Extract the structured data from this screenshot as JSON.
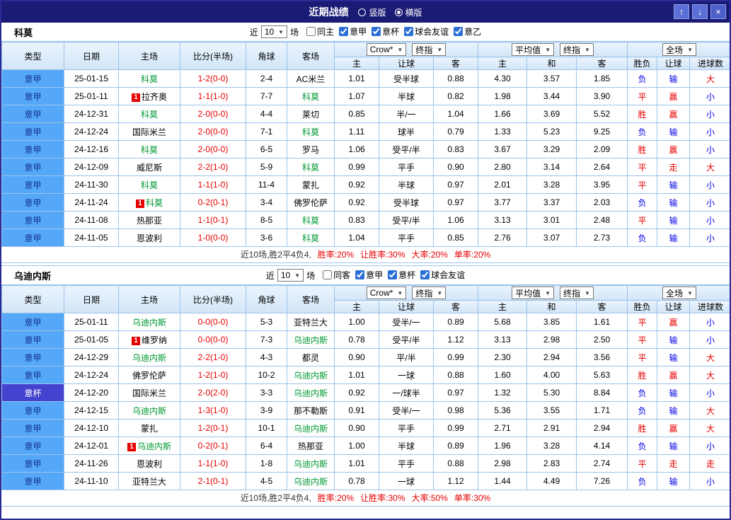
{
  "titlebar": {
    "title": "近期战绩",
    "radios": [
      {
        "label": "竖版",
        "checked": false
      },
      {
        "label": "横版",
        "checked": true
      }
    ],
    "up_icon": "↑",
    "down_icon": "↓",
    "close_icon": "×"
  },
  "columns": {
    "type": "类型",
    "date": "日期",
    "home": "主场",
    "score": "比分(半场)",
    "corner": "角球",
    "away": "客场",
    "odds_home": "主",
    "odds_handicap": "让球",
    "odds_away": "客",
    "avg_home": "主",
    "avg_draw": "和",
    "avg_away": "客",
    "result": "胜负",
    "handicap_result": "让球",
    "goals": "进球数"
  },
  "colors": {
    "accent_blue": "#55a8f8",
    "cup_blue": "#4343cf",
    "green_team": "#009933",
    "red": "#e60000",
    "blue": "#0000e6",
    "titlebar": "#1b1b75"
  },
  "sections": [
    {
      "team": "科莫",
      "filter": {
        "near": "近",
        "count": "10",
        "games": "场",
        "checkboxes": [
          {
            "label": "同主",
            "checked": false
          },
          {
            "label": "意甲",
            "checked": true
          },
          {
            "label": "意杯",
            "checked": true
          },
          {
            "label": "球会友谊",
            "checked": true
          },
          {
            "label": "意乙",
            "checked": true
          }
        ]
      },
      "dropdowns": {
        "odds_source": "Crow*",
        "odds_final": "终指",
        "avg_source": "平均值",
        "avg_final": "终指",
        "scope": "全场"
      },
      "rows": [
        {
          "type": "意甲",
          "tc": "t-jia",
          "date": "25-01-15",
          "home": {
            "name": "科莫",
            "green": true
          },
          "score": "1-2(0-0)",
          "corner": "2-4",
          "away": {
            "name": "AC米兰"
          },
          "odds": [
            "1.01",
            "受半球",
            "0.88"
          ],
          "avg": [
            "4.30",
            "3.57",
            "1.85"
          ],
          "result": [
            "负",
            "blue"
          ],
          "hcp": [
            "输",
            "blue"
          ],
          "goals": [
            "大",
            "red"
          ]
        },
        {
          "type": "意甲",
          "tc": "t-jia",
          "date": "25-01-11",
          "home": {
            "name": "拉齐奥",
            "badge": true
          },
          "score": "1-1(1-0)",
          "corner": "7-7",
          "away": {
            "name": "科莫",
            "green": true
          },
          "odds": [
            "1.07",
            "半球",
            "0.82"
          ],
          "avg": [
            "1.98",
            "3.44",
            "3.90"
          ],
          "result": [
            "平",
            "red"
          ],
          "hcp": [
            "赢",
            "red"
          ],
          "goals": [
            "小",
            "blue"
          ]
        },
        {
          "type": "意甲",
          "tc": "t-jia",
          "date": "24-12-31",
          "home": {
            "name": "科莫",
            "green": true
          },
          "score": "2-0(0-0)",
          "corner": "4-4",
          "away": {
            "name": "莱切"
          },
          "odds": [
            "0.85",
            "半/一",
            "1.04"
          ],
          "avg": [
            "1.66",
            "3.69",
            "5.52"
          ],
          "result": [
            "胜",
            "red"
          ],
          "hcp": [
            "赢",
            "red"
          ],
          "goals": [
            "小",
            "blue"
          ]
        },
        {
          "type": "意甲",
          "tc": "t-jia",
          "date": "24-12-24",
          "home": {
            "name": "国际米兰"
          },
          "score": "2-0(0-0)",
          "corner": "7-1",
          "away": {
            "name": "科莫",
            "green": true
          },
          "odds": [
            "1.11",
            "球半",
            "0.79"
          ],
          "avg": [
            "1.33",
            "5.23",
            "9.25"
          ],
          "result": [
            "负",
            "blue"
          ],
          "hcp": [
            "输",
            "blue"
          ],
          "goals": [
            "小",
            "blue"
          ]
        },
        {
          "type": "意甲",
          "tc": "t-jia",
          "date": "24-12-16",
          "home": {
            "name": "科莫",
            "green": true
          },
          "score": "2-0(0-0)",
          "corner": "6-5",
          "away": {
            "name": "罗马"
          },
          "odds": [
            "1.06",
            "受平/半",
            "0.83"
          ],
          "avg": [
            "3.67",
            "3.29",
            "2.09"
          ],
          "result": [
            "胜",
            "red"
          ],
          "hcp": [
            "赢",
            "red"
          ],
          "goals": [
            "小",
            "blue"
          ]
        },
        {
          "type": "意甲",
          "tc": "t-jia",
          "date": "24-12-09",
          "home": {
            "name": "威尼斯"
          },
          "score": "2-2(1-0)",
          "corner": "5-9",
          "away": {
            "name": "科莫",
            "green": true
          },
          "odds": [
            "0.99",
            "平手",
            "0.90"
          ],
          "avg": [
            "2.80",
            "3.14",
            "2.64"
          ],
          "result": [
            "平",
            "red"
          ],
          "hcp": [
            "走",
            "red"
          ],
          "goals": [
            "大",
            "red"
          ]
        },
        {
          "type": "意甲",
          "tc": "t-jia",
          "date": "24-11-30",
          "home": {
            "name": "科莫",
            "green": true
          },
          "score": "1-1(1-0)",
          "corner": "11-4",
          "away": {
            "name": "蒙扎"
          },
          "odds": [
            "0.92",
            "半球",
            "0.97"
          ],
          "avg": [
            "2.01",
            "3.28",
            "3.95"
          ],
          "result": [
            "平",
            "red"
          ],
          "hcp": [
            "输",
            "blue"
          ],
          "goals": [
            "小",
            "blue"
          ]
        },
        {
          "type": "意甲",
          "tc": "t-jia",
          "date": "24-11-24",
          "home": {
            "name": "科莫",
            "green": true,
            "badge": true
          },
          "score": "0-2(0-1)",
          "corner": "3-4",
          "away": {
            "name": "佛罗伦萨"
          },
          "odds": [
            "0.92",
            "受半球",
            "0.97"
          ],
          "avg": [
            "3.77",
            "3.37",
            "2.03"
          ],
          "result": [
            "负",
            "blue"
          ],
          "hcp": [
            "输",
            "blue"
          ],
          "goals": [
            "小",
            "blue"
          ]
        },
        {
          "type": "意甲",
          "tc": "t-jia",
          "date": "24-11-08",
          "home": {
            "name": "热那亚"
          },
          "score": "1-1(0-1)",
          "corner": "8-5",
          "away": {
            "name": "科莫",
            "green": true
          },
          "odds": [
            "0.83",
            "受平/半",
            "1.06"
          ],
          "avg": [
            "3.13",
            "3.01",
            "2.48"
          ],
          "result": [
            "平",
            "red"
          ],
          "hcp": [
            "输",
            "blue"
          ],
          "goals": [
            "小",
            "blue"
          ]
        },
        {
          "type": "意甲",
          "tc": "t-jia",
          "date": "24-11-05",
          "home": {
            "name": "恩波利"
          },
          "score": "1-0(0-0)",
          "corner": "3-6",
          "away": {
            "name": "科莫",
            "green": true
          },
          "odds": [
            "1.04",
            "平手",
            "0.85"
          ],
          "avg": [
            "2.76",
            "3.07",
            "2.73"
          ],
          "result": [
            "负",
            "blue"
          ],
          "hcp": [
            "输",
            "blue"
          ],
          "goals": [
            "小",
            "blue"
          ]
        }
      ],
      "summary": {
        "prefix": "近10场,胜2平4负4,",
        "stats": [
          "胜率:20%",
          "让胜率:30%",
          "大率:20%",
          "单率:20%"
        ]
      }
    },
    {
      "team": "乌迪内斯",
      "filter": {
        "near": "近",
        "count": "10",
        "games": "场",
        "checkboxes": [
          {
            "label": "同客",
            "checked": false
          },
          {
            "label": "意甲",
            "checked": true
          },
          {
            "label": "意杯",
            "checked": true
          },
          {
            "label": "球会友谊",
            "checked": true
          }
        ]
      },
      "dropdowns": {
        "odds_source": "Crow*",
        "odds_final": "终指",
        "avg_source": "平均值",
        "avg_final": "终指",
        "scope": "全场"
      },
      "rows": [
        {
          "type": "意甲",
          "tc": "t-jia",
          "date": "25-01-11",
          "home": {
            "name": "乌迪内斯",
            "green": true
          },
          "score": "0-0(0-0)",
          "corner": "5-3",
          "away": {
            "name": "亚特兰大"
          },
          "odds": [
            "1.00",
            "受半/一",
            "0.89"
          ],
          "avg": [
            "5.68",
            "3.85",
            "1.61"
          ],
          "result": [
            "平",
            "red"
          ],
          "hcp": [
            "赢",
            "red"
          ],
          "goals": [
            "小",
            "blue"
          ]
        },
        {
          "type": "意甲",
          "tc": "t-jia",
          "date": "25-01-05",
          "home": {
            "name": "维罗纳",
            "badge": true
          },
          "score": "0-0(0-0)",
          "corner": "7-3",
          "away": {
            "name": "乌迪内斯",
            "green": true
          },
          "odds": [
            "0.78",
            "受平/半",
            "1.12"
          ],
          "avg": [
            "3.13",
            "2.98",
            "2.50"
          ],
          "result": [
            "平",
            "red"
          ],
          "hcp": [
            "输",
            "blue"
          ],
          "goals": [
            "小",
            "blue"
          ]
        },
        {
          "type": "意甲",
          "tc": "t-jia",
          "date": "24-12-29",
          "home": {
            "name": "乌迪内斯",
            "green": true
          },
          "score": "2-2(1-0)",
          "corner": "4-3",
          "away": {
            "name": "都灵"
          },
          "odds": [
            "0.90",
            "平/半",
            "0.99"
          ],
          "avg": [
            "2.30",
            "2.94",
            "3.56"
          ],
          "result": [
            "平",
            "red"
          ],
          "hcp": [
            "输",
            "blue"
          ],
          "goals": [
            "大",
            "red"
          ]
        },
        {
          "type": "意甲",
          "tc": "t-jia",
          "date": "24-12-24",
          "home": {
            "name": "佛罗伦萨"
          },
          "score": "1-2(1-0)",
          "corner": "10-2",
          "away": {
            "name": "乌迪内斯",
            "green": true
          },
          "odds": [
            "1.01",
            "一球",
            "0.88"
          ],
          "avg": [
            "1.60",
            "4.00",
            "5.63"
          ],
          "result": [
            "胜",
            "red"
          ],
          "hcp": [
            "赢",
            "red"
          ],
          "goals": [
            "大",
            "red"
          ]
        },
        {
          "type": "意杯",
          "tc": "t-bei",
          "date": "24-12-20",
          "home": {
            "name": "国际米兰"
          },
          "score": "2-0(2-0)",
          "corner": "3-3",
          "away": {
            "name": "乌迪内斯",
            "green": true
          },
          "odds": [
            "0.92",
            "一/球半",
            "0.97"
          ],
          "avg": [
            "1.32",
            "5.30",
            "8.84"
          ],
          "result": [
            "负",
            "blue"
          ],
          "hcp": [
            "输",
            "blue"
          ],
          "goals": [
            "小",
            "blue"
          ]
        },
        {
          "type": "意甲",
          "tc": "t-jia",
          "date": "24-12-15",
          "home": {
            "name": "乌迪内斯",
            "green": true
          },
          "score": "1-3(1-0)",
          "corner": "3-9",
          "away": {
            "name": "那不勒斯"
          },
          "odds": [
            "0.91",
            "受半/一",
            "0.98"
          ],
          "avg": [
            "5.36",
            "3.55",
            "1.71"
          ],
          "result": [
            "负",
            "blue"
          ],
          "hcp": [
            "输",
            "blue"
          ],
          "goals": [
            "大",
            "red"
          ]
        },
        {
          "type": "意甲",
          "tc": "t-jia",
          "date": "24-12-10",
          "home": {
            "name": "蒙扎"
          },
          "score": "1-2(0-1)",
          "corner": "10-1",
          "away": {
            "name": "乌迪内斯",
            "green": true
          },
          "odds": [
            "0.90",
            "平手",
            "0.99"
          ],
          "avg": [
            "2.71",
            "2.91",
            "2.94"
          ],
          "result": [
            "胜",
            "red"
          ],
          "hcp": [
            "赢",
            "red"
          ],
          "goals": [
            "大",
            "red"
          ]
        },
        {
          "type": "意甲",
          "tc": "t-jia",
          "date": "24-12-01",
          "home": {
            "name": "乌迪内斯",
            "green": true,
            "badge": true
          },
          "score": "0-2(0-1)",
          "corner": "6-4",
          "away": {
            "name": "热那亚"
          },
          "odds": [
            "1.00",
            "半球",
            "0.89"
          ],
          "avg": [
            "1.96",
            "3.28",
            "4.14"
          ],
          "result": [
            "负",
            "blue"
          ],
          "hcp": [
            "输",
            "blue"
          ],
          "goals": [
            "小",
            "blue"
          ]
        },
        {
          "type": "意甲",
          "tc": "t-jia",
          "date": "24-11-26",
          "home": {
            "name": "恩波利"
          },
          "score": "1-1(1-0)",
          "corner": "1-8",
          "away": {
            "name": "乌迪内斯",
            "green": true
          },
          "odds": [
            "1.01",
            "平手",
            "0.88"
          ],
          "avg": [
            "2.98",
            "2.83",
            "2.74"
          ],
          "result": [
            "平",
            "red"
          ],
          "hcp": [
            "走",
            "red"
          ],
          "goals": [
            "走",
            "red"
          ]
        },
        {
          "type": "意甲",
          "tc": "t-jia",
          "date": "24-11-10",
          "home": {
            "name": "亚特兰大"
          },
          "score": "2-1(0-1)",
          "corner": "4-5",
          "away": {
            "name": "乌迪内斯",
            "green": true
          },
          "odds": [
            "0.78",
            "一球",
            "1.12"
          ],
          "avg": [
            "1.44",
            "4.49",
            "7.26"
          ],
          "result": [
            "负",
            "blue"
          ],
          "hcp": [
            "输",
            "blue"
          ],
          "goals": [
            "小",
            "blue"
          ]
        }
      ],
      "summary": {
        "prefix": "近10场,胜2平4负4,",
        "stats": [
          "胜率:20%",
          "让胜率:30%",
          "大率:50%",
          "单率:30%"
        ]
      }
    }
  ]
}
